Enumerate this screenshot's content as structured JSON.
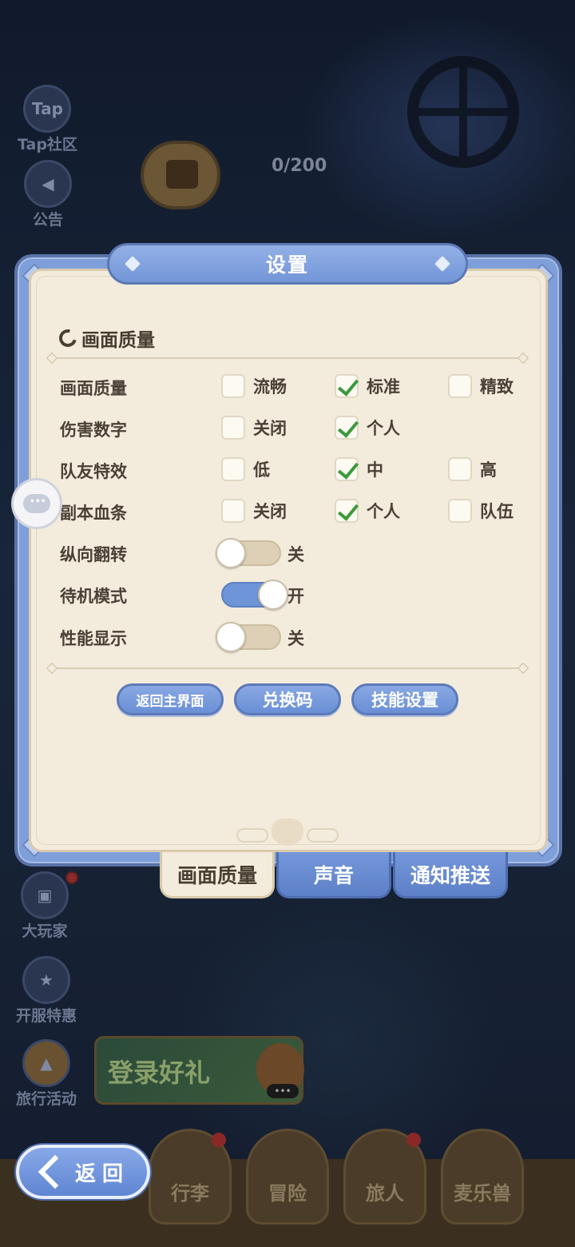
{
  "background": {
    "counter": "0/200",
    "side_buttons": [
      {
        "icon_text": "Tap",
        "label": "Tap社区"
      },
      {
        "label": "公告"
      },
      {
        "label": "大玩家"
      },
      {
        "label": "开服特惠"
      },
      {
        "label": "旅行活动"
      }
    ],
    "login_banner": "登录好礼",
    "banner_dots": "•••",
    "nav": [
      "行李",
      "冒险",
      "旅人",
      "麦乐兽"
    ]
  },
  "dialog": {
    "title": "设置",
    "section_title": "画面质量",
    "rows": [
      {
        "label": "画面质量",
        "options": [
          {
            "label": "流畅",
            "checked": false
          },
          {
            "label": "标准",
            "checked": true
          },
          {
            "label": "精致",
            "checked": false
          }
        ]
      },
      {
        "label": "伤害数字",
        "options": [
          {
            "label": "关闭",
            "checked": false
          },
          {
            "label": "个人",
            "checked": true
          }
        ]
      },
      {
        "label": "队友特效",
        "options": [
          {
            "label": "低",
            "checked": false
          },
          {
            "label": "中",
            "checked": true
          },
          {
            "label": "高",
            "checked": false
          }
        ]
      },
      {
        "label": "副本血条",
        "options": [
          {
            "label": "关闭",
            "checked": false
          },
          {
            "label": "个人",
            "checked": true
          },
          {
            "label": "队伍",
            "checked": false
          }
        ]
      }
    ],
    "toggles": [
      {
        "label": "纵向翻转",
        "on": false,
        "state": "关"
      },
      {
        "label": "待机模式",
        "on": true,
        "state": "开"
      },
      {
        "label": "性能显示",
        "on": false,
        "state": "关"
      }
    ],
    "buttons": {
      "return_main": "返回主界面",
      "redeem_code": "兑换码",
      "skill_settings": "技能设置"
    },
    "tabs": {
      "graphics": "画面质量",
      "sound": "声音",
      "notifications": "通知推送"
    }
  },
  "back_button": "返回",
  "colors": {
    "accent_blue": "#7396d8",
    "panel_cream": "#f3ecdc",
    "check_green": "#3a9a3a"
  }
}
